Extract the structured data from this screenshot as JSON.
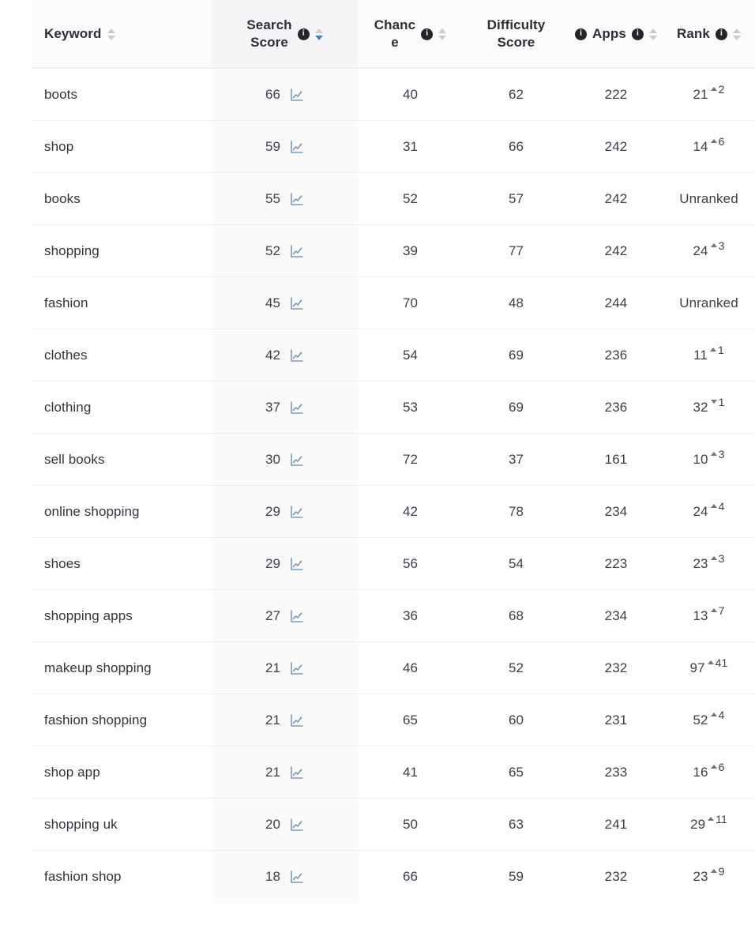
{
  "table": {
    "columns": [
      {
        "id": "keyword",
        "label": "Keyword",
        "align": "left",
        "has_info": false,
        "has_sort": true,
        "sort_state": "none",
        "shaded": false
      },
      {
        "id": "search_score",
        "label": "Search\nScore",
        "align": "center",
        "has_info": true,
        "has_sort": true,
        "sort_state": "desc",
        "shaded": true
      },
      {
        "id": "chance",
        "label": "Chanc\ne",
        "align": "center",
        "has_info": true,
        "has_sort": true,
        "sort_state": "none",
        "shaded": false
      },
      {
        "id": "difficulty",
        "label": "Difficulty\nScore",
        "align": "center",
        "has_info": true,
        "has_sort": false,
        "sort_state": "none",
        "shaded": false
      },
      {
        "id": "apps",
        "label": "Apps",
        "align": "center",
        "has_info": true,
        "has_sort": true,
        "sort_state": "none",
        "shaded": false
      },
      {
        "id": "rank",
        "label": "Rank",
        "align": "center",
        "has_info": true,
        "has_sort": true,
        "sort_state": "none",
        "shaded": false
      }
    ],
    "column_labels": {
      "keyword": "Keyword",
      "search_score_line1": "Search",
      "search_score_line2": "Score",
      "chance_line1": "Chanc",
      "chance_line2": "e",
      "difficulty_line1": "Difficulty",
      "difficulty_line2": "Score",
      "apps": "Apps",
      "rank": "Rank"
    },
    "icons": {
      "info": "info-icon",
      "sort": "sort-arrows-icon",
      "trend_chart": "line-chart-icon",
      "rank_up": "triangle-up-icon",
      "rank_down": "triangle-down-icon"
    },
    "unranked_label": "Unranked",
    "rows": [
      {
        "keyword": "boots",
        "search_score": "66",
        "chance": "40",
        "difficulty": "62",
        "apps": "222",
        "rank": "21",
        "rank_dir": "up",
        "rank_delta": "2",
        "unranked": false
      },
      {
        "keyword": "shop",
        "search_score": "59",
        "chance": "31",
        "difficulty": "66",
        "apps": "242",
        "rank": "14",
        "rank_dir": "up",
        "rank_delta": "6",
        "unranked": false
      },
      {
        "keyword": "books",
        "search_score": "55",
        "chance": "52",
        "difficulty": "57",
        "apps": "242",
        "rank": "Unranked",
        "rank_dir": "none",
        "rank_delta": "",
        "unranked": true
      },
      {
        "keyword": "shopping",
        "search_score": "52",
        "chance": "39",
        "difficulty": "77",
        "apps": "242",
        "rank": "24",
        "rank_dir": "up",
        "rank_delta": "3",
        "unranked": false
      },
      {
        "keyword": "fashion",
        "search_score": "45",
        "chance": "70",
        "difficulty": "48",
        "apps": "244",
        "rank": "Unranked",
        "rank_dir": "none",
        "rank_delta": "",
        "unranked": true
      },
      {
        "keyword": "clothes",
        "search_score": "42",
        "chance": "54",
        "difficulty": "69",
        "apps": "236",
        "rank": "11",
        "rank_dir": "up",
        "rank_delta": "1",
        "unranked": false
      },
      {
        "keyword": "clothing",
        "search_score": "37",
        "chance": "53",
        "difficulty": "69",
        "apps": "236",
        "rank": "32",
        "rank_dir": "down",
        "rank_delta": "1",
        "unranked": false
      },
      {
        "keyword": "sell books",
        "search_score": "30",
        "chance": "72",
        "difficulty": "37",
        "apps": "161",
        "rank": "10",
        "rank_dir": "up",
        "rank_delta": "3",
        "unranked": false
      },
      {
        "keyword": "online shopping",
        "search_score": "29",
        "chance": "42",
        "difficulty": "78",
        "apps": "234",
        "rank": "24",
        "rank_dir": "up",
        "rank_delta": "4",
        "unranked": false
      },
      {
        "keyword": "shoes",
        "search_score": "29",
        "chance": "56",
        "difficulty": "54",
        "apps": "223",
        "rank": "23",
        "rank_dir": "up",
        "rank_delta": "3",
        "unranked": false
      },
      {
        "keyword": "shopping apps",
        "search_score": "27",
        "chance": "36",
        "difficulty": "68",
        "apps": "234",
        "rank": "13",
        "rank_dir": "up",
        "rank_delta": "7",
        "unranked": false
      },
      {
        "keyword": "makeup shopping",
        "search_score": "21",
        "chance": "46",
        "difficulty": "52",
        "apps": "232",
        "rank": "97",
        "rank_dir": "up",
        "rank_delta": "41",
        "unranked": false
      },
      {
        "keyword": "fashion shopping",
        "search_score": "21",
        "chance": "65",
        "difficulty": "60",
        "apps": "231",
        "rank": "52",
        "rank_dir": "up",
        "rank_delta": "4",
        "unranked": false
      },
      {
        "keyword": "shop app",
        "search_score": "21",
        "chance": "41",
        "difficulty": "65",
        "apps": "233",
        "rank": "16",
        "rank_dir": "up",
        "rank_delta": "6",
        "unranked": false
      },
      {
        "keyword": "shopping uk",
        "search_score": "20",
        "chance": "50",
        "difficulty": "63",
        "apps": "241",
        "rank": "29",
        "rank_dir": "up",
        "rank_delta": "11",
        "unranked": false
      },
      {
        "keyword": "fashion shop",
        "search_score": "18",
        "chance": "66",
        "difficulty": "59",
        "apps": "232",
        "rank": "23",
        "rank_dir": "up",
        "rank_delta": "9",
        "unranked": false
      }
    ]
  },
  "colors": {
    "accent_blue": "#3e7fbf",
    "chart_icon": "#7e99b8",
    "text": "#3b4049",
    "header_bg": "#fbfbfc",
    "shaded_col": "#f5f5f7",
    "row_border": "#eeeff1"
  }
}
